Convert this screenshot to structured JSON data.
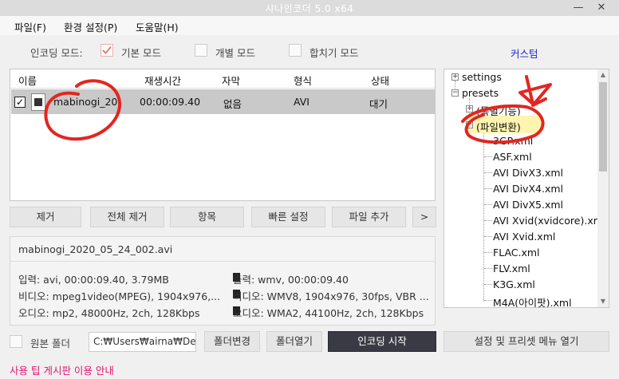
{
  "window": {
    "title": "샤나인코더  5.0 x64",
    "minimize": "—",
    "close": "✕"
  },
  "menu": [
    "파일(F)",
    "환경 설정(P)",
    "도움말(H)"
  ],
  "modes": {
    "label": "인코딩 모드:",
    "basic": "기본 모드",
    "individual": "개별 모드",
    "merge": "합치기 모드",
    "custom": "커스텀"
  },
  "list": {
    "headers": [
      "이름",
      "재생시간",
      "자막",
      "형식",
      "상태"
    ],
    "rows": [
      {
        "checked": "✓",
        "name": "mabinogi_20",
        "duration": "00:00:09.40",
        "subtitle": "없음",
        "format": "AVI",
        "status": "대기"
      }
    ]
  },
  "actions": [
    "제거",
    "전체 제거",
    "항목",
    "빠른 설정",
    "파일 추가",
    ">"
  ],
  "info": {
    "filename": "mabinogi_2020_05_24_002.avi",
    "input": "입력: avi, 00:00:09.40, 3.79MB",
    "output": "출력: wmv, 00:00:09.40",
    "video_in": "비디오: mpeg1video(MPEG), 1904x976,...",
    "video_out": "비디오: WMV8, 1904x976, 30fps, VBR ...",
    "audio_in": "오디오: mp2, 48000Hz, 2ch, 128Kbps",
    "audio_out": "오디오: WMA2, 44100Hz, 2ch, 128Kbps"
  },
  "tree": {
    "root1": "settings",
    "root2": "presets",
    "sub1": "(특별기능)",
    "sub2": "(파일변환)",
    "files": [
      "3GP.xml",
      "ASF.xml",
      "AVI  DivX3.xml",
      "AVI  DivX4.xml",
      "AVI  DivX5.xml",
      "AVI  Xvid(xvidcore).xml",
      "AVI  Xvid.xml",
      "FLAC.xml",
      "FLV.xml",
      "K3G.xml",
      "M4A(아이팟).xml"
    ]
  },
  "bottom": {
    "source_folder": "원본 폴더",
    "path": "C:₩Users₩airna₩Des",
    "change_folder": "폴더변경",
    "open_folder": "폴더열기",
    "start": "인코딩 시작",
    "preset_menu": "설정 및 프리셋 메뉴 열기"
  },
  "tips": "사용 팁 게시판 이용 안내",
  "colors": {
    "accent_link": "#1a24d0",
    "tips": "#e0166f",
    "annotation": "#e3261f",
    "highlight": "#fff4b0"
  }
}
